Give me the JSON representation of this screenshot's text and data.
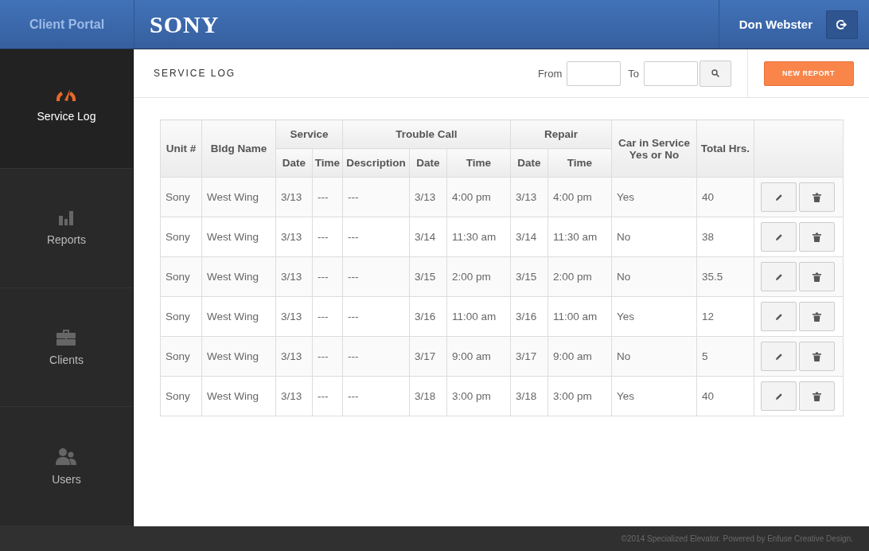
{
  "header": {
    "portal_title": "Client Portal",
    "logo": "SONY",
    "user_name": "Don Webster"
  },
  "sidebar": {
    "items": [
      {
        "label": "Service Log",
        "selected": true
      },
      {
        "label": "Reports",
        "selected": false
      },
      {
        "label": "Clients",
        "selected": false
      },
      {
        "label": "Users",
        "selected": false
      }
    ]
  },
  "toolbar": {
    "title": "SERVICE LOG",
    "from_label": "From",
    "to_label": "To",
    "new_report_button": "NEW REPORT"
  },
  "table": {
    "group_headers": [
      {
        "label": "Unit #"
      },
      {
        "label": "Bldg Name"
      },
      {
        "label": "Service",
        "sub_headers": [
          "Date",
          "Time"
        ]
      },
      {
        "label": "Trouble Call",
        "sub_headers": [
          "Description",
          "Date",
          "Time"
        ]
      },
      {
        "label": "Repair",
        "sub_headers": [
          "Date",
          "Time"
        ]
      },
      {
        "label": "Car in Service Yes or No"
      },
      {
        "label": "Total Hrs."
      }
    ],
    "rows": [
      [
        "Sony",
        "West Wing",
        "3/13",
        "---",
        "---",
        "3/13",
        "4:00 pm",
        "3/13",
        "4:00 pm",
        "Yes",
        "40"
      ],
      [
        "Sony",
        "West Wing",
        "3/13",
        "---",
        "---",
        "3/14",
        "11:30 am",
        "3/14",
        "11:30 am",
        "No",
        "38"
      ],
      [
        "Sony",
        "West Wing",
        "3/13",
        "---",
        "---",
        "3/15",
        "2:00 pm",
        "3/15",
        "2:00 pm",
        "No",
        "35.5"
      ],
      [
        "Sony",
        "West Wing",
        "3/13",
        "---",
        "---",
        "3/16",
        "11:00 am",
        "3/16",
        "11:00 am",
        "Yes",
        "12"
      ],
      [
        "Sony",
        "West Wing",
        "3/13",
        "---",
        "---",
        "3/17",
        "9:00 am",
        "3/17",
        "9:00 am",
        "No",
        "5"
      ],
      [
        "Sony",
        "West Wing",
        "3/13",
        "---",
        "---",
        "3/18",
        "3:00 pm",
        "3/18",
        "3:00 pm",
        "Yes",
        "40"
      ]
    ]
  },
  "footer": "©2014 Specialized Elevator. Powered by Enfuse Creative Design."
}
